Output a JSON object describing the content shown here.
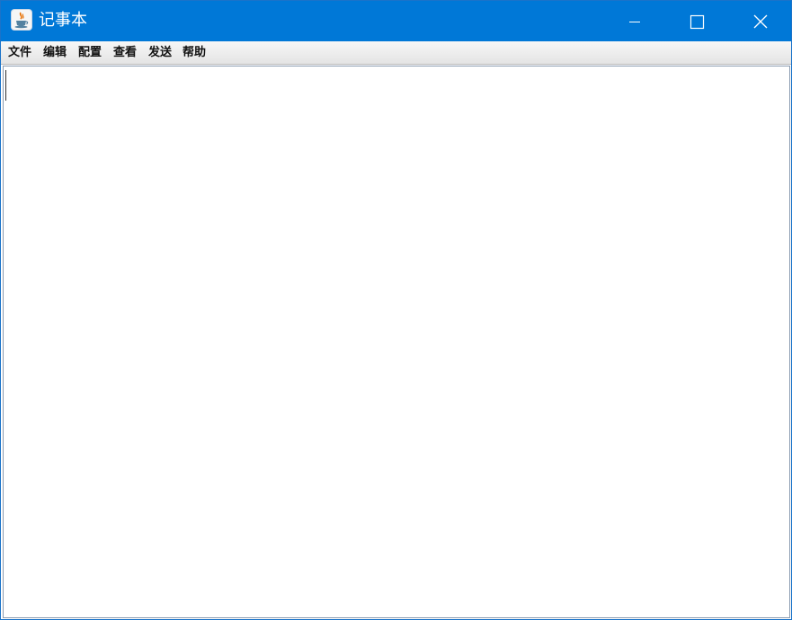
{
  "window": {
    "title": "记事本",
    "app_icon": "java-coffee-cup-icon"
  },
  "controls": {
    "minimize_icon": "minimize-icon",
    "maximize_icon": "maximize-icon",
    "close_icon": "close-icon"
  },
  "menubar": {
    "items": [
      {
        "label": "文件"
      },
      {
        "label": "编辑"
      },
      {
        "label": "配置"
      },
      {
        "label": "查看"
      },
      {
        "label": "发送"
      },
      {
        "label": "帮助"
      }
    ]
  },
  "editor": {
    "content": ""
  },
  "colors": {
    "titlebar": "#0078d7",
    "title_text": "#ffffff",
    "menubar": "#eeeeee",
    "editor_background": "#ffffff"
  }
}
